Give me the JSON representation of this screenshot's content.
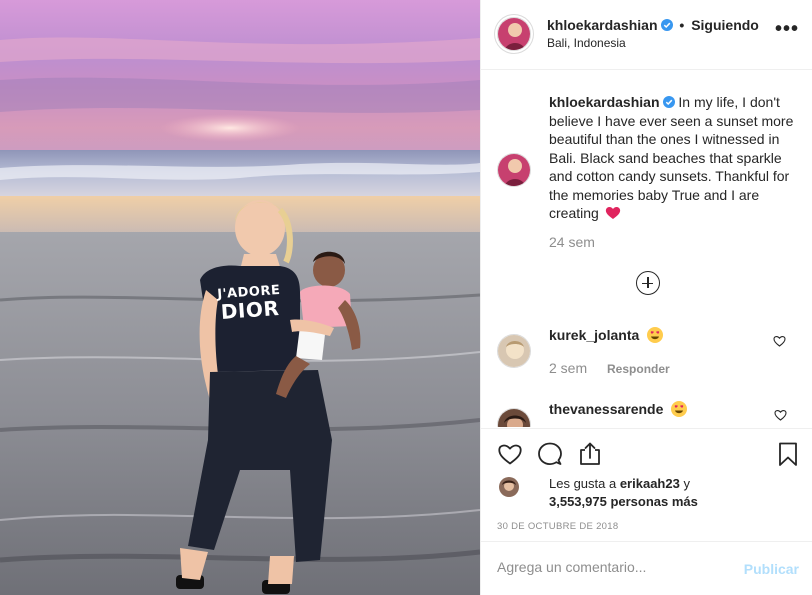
{
  "post": {
    "author": "khloekardashian",
    "follow_status": "Siguiendo",
    "dot": "•",
    "location": "Bali, Indonesia",
    "more_label": "•••",
    "shirt_line1": "J'ADORE",
    "shirt_line2": "DIOR"
  },
  "caption": {
    "username": "khloekardashian",
    "text": "In my life, I don't believe I have ever seen a sunset more beautiful than the ones I witnessed in Bali. Black sand beaches that sparkle and cotton candy sunsets. Thankful for the memories baby True and I are creating",
    "emoji": "red-heart",
    "time": "24 sem"
  },
  "comments": [
    {
      "username": "kurek_jolanta",
      "emoji": "heart-eyes",
      "time": "2 sem",
      "reply": "Responder"
    },
    {
      "username": "thevanessarende",
      "emoji": "heart-eyes"
    }
  ],
  "likes": {
    "prefix": "Les gusta a ",
    "user": "erikaah23",
    "mid": " y",
    "count": "3,553,975 personas más"
  },
  "date": "30 de octubre de 2018",
  "comment_box": {
    "placeholder": "Agrega un comentario...",
    "publish_label": "Publicar"
  },
  "colors": {
    "verified": "#3897f0",
    "publish_disabled": "#b2dffc",
    "muted": "#8e8e8e",
    "heart_emoji": "#e0245e"
  }
}
